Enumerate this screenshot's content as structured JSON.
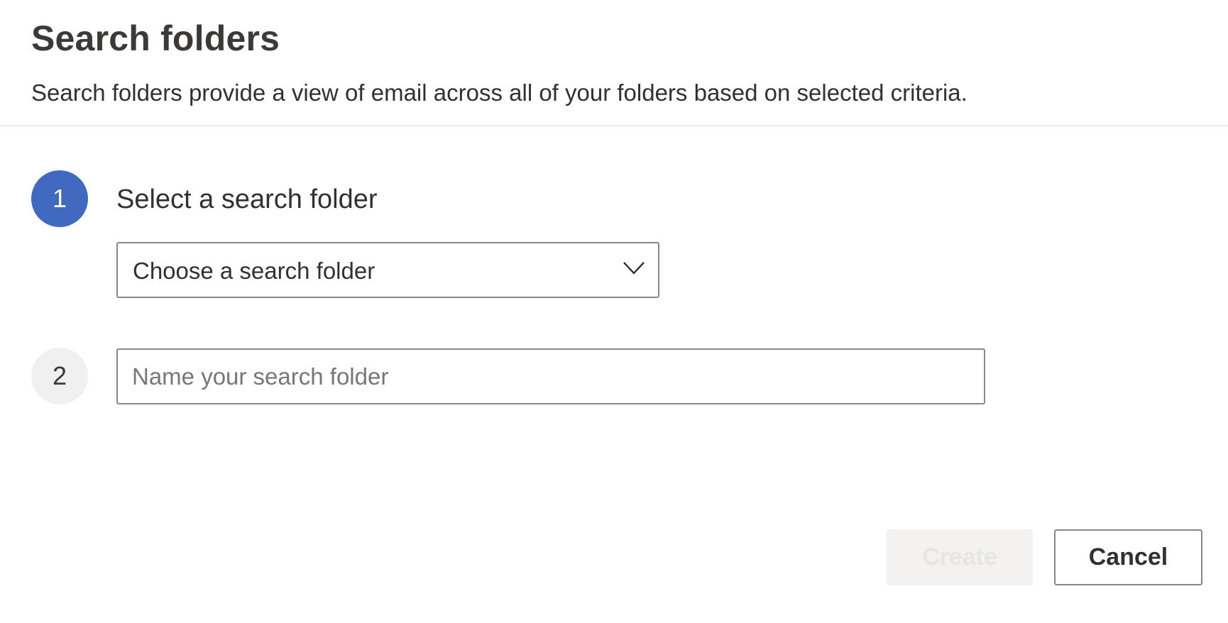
{
  "dialog": {
    "title": "Search folders",
    "subtitle": "Search folders provide a view of email across all of your folders based on selected criteria."
  },
  "steps": [
    {
      "number": "1",
      "label": "Select a search folder",
      "state": "active",
      "dropdown": {
        "value": "Choose a search folder",
        "icon": "chevron-down-icon"
      }
    },
    {
      "number": "2",
      "state": "inactive",
      "input": {
        "value": "",
        "placeholder": "Name your search folder"
      }
    }
  ],
  "buttons": {
    "create_label": "Create",
    "create_disabled": true,
    "cancel_label": "Cancel"
  },
  "colors": {
    "accent": "#4169c0",
    "inactive_step": "#f0f0f0",
    "border": "#8a8886",
    "text": "#323130",
    "disabled_button": "#f3f2f1"
  }
}
